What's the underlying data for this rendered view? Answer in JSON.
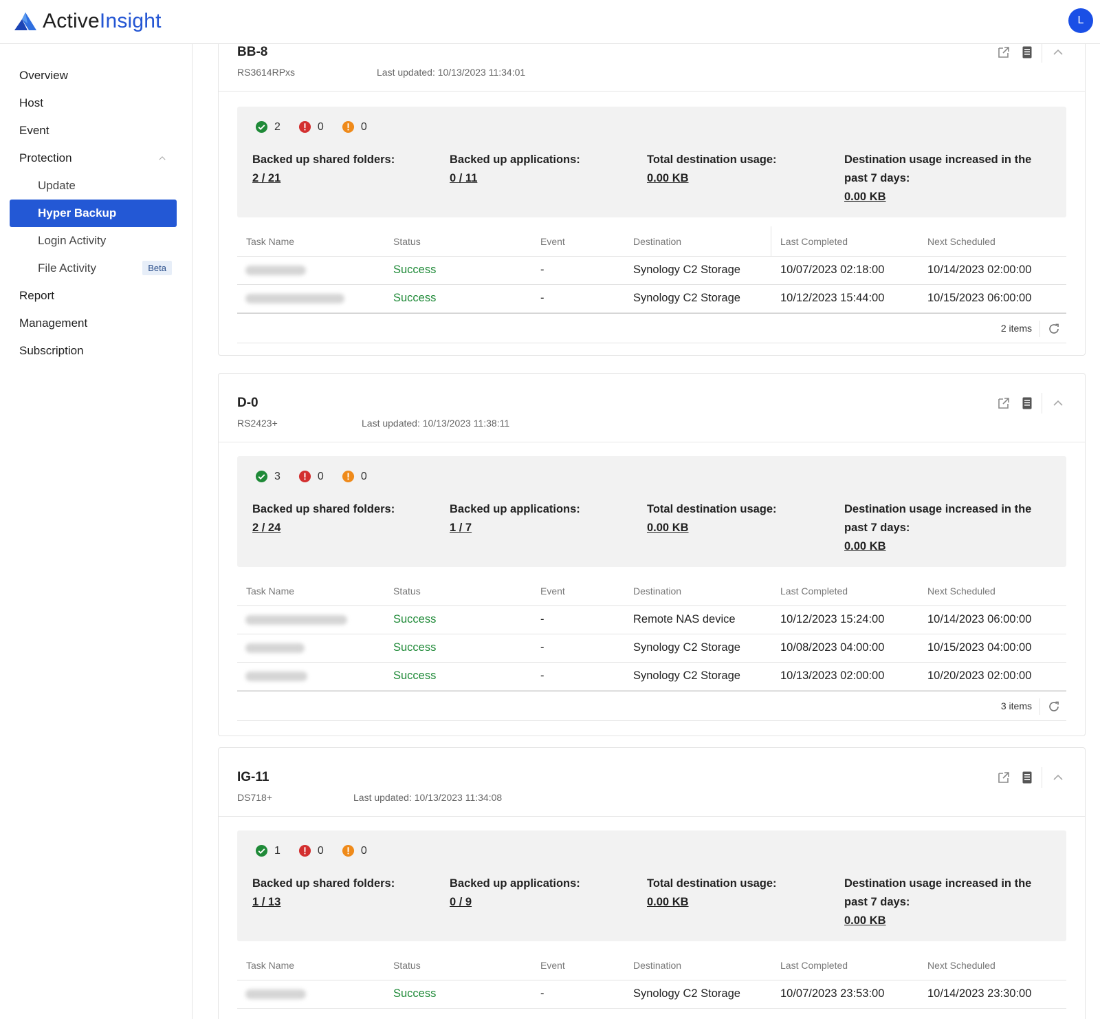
{
  "app": {
    "logo_text_a": "Active",
    "logo_text_b": "Insight",
    "user_initial": "L"
  },
  "sidebar": {
    "items": [
      {
        "label": "Overview"
      },
      {
        "label": "Host"
      },
      {
        "label": "Event"
      },
      {
        "label": "Protection"
      },
      {
        "label": "Update"
      },
      {
        "label": "Hyper Backup"
      },
      {
        "label": "Login Activity"
      },
      {
        "label": "File Activity",
        "badge": "Beta"
      },
      {
        "label": "Report"
      },
      {
        "label": "Management"
      },
      {
        "label": "Subscription"
      }
    ]
  },
  "labels": {
    "shared_folders": "Backed up shared folders:",
    "applications": "Backed up applications:",
    "total_usage": "Total destination usage:",
    "usage_increase": "Destination usage increased in the past 7 days:",
    "col_task": "Task Name",
    "col_status": "Status",
    "col_event": "Event",
    "col_destination": "Destination",
    "col_last": "Last Completed",
    "col_next": "Next Scheduled"
  },
  "colors": {
    "accent": "#2358d5",
    "success": "#1f8a38",
    "error": "#d32f2f",
    "warning": "#ef8a1a"
  },
  "hosts": [
    {
      "name": "BB-8",
      "model": "RS3614RPxs",
      "updated": "Last updated: 10/13/2023 11:34:01",
      "counts": {
        "success": "2",
        "error": "0",
        "warning": "0"
      },
      "shared_folders": "2 / 21",
      "applications": "0 / 11",
      "total_usage": "0.00 KB",
      "usage_increase": "0.00 KB",
      "rows": [
        {
          "status": "Success",
          "event": "-",
          "destination": "Synology C2 Storage",
          "last": "10/07/2023 02:18:00",
          "next": "10/14/2023 02:00:00"
        },
        {
          "status": "Success",
          "event": "-",
          "destination": "Synology C2 Storage",
          "last": "10/12/2023 15:44:00",
          "next": "10/15/2023 06:00:00"
        }
      ],
      "items": "2 items"
    },
    {
      "name": "D-0",
      "model": "RS2423+",
      "updated": "Last updated: 10/13/2023 11:38:11",
      "counts": {
        "success": "3",
        "error": "0",
        "warning": "0"
      },
      "shared_folders": "2 / 24",
      "applications": "1 / 7",
      "total_usage": "0.00 KB",
      "usage_increase": "0.00 KB",
      "rows": [
        {
          "status": "Success",
          "event": "-",
          "destination": "Remote NAS device",
          "last": "10/12/2023 15:24:00",
          "next": "10/14/2023 06:00:00"
        },
        {
          "status": "Success",
          "event": "-",
          "destination": "Synology C2 Storage",
          "last": "10/08/2023 04:00:00",
          "next": "10/15/2023 04:00:00"
        },
        {
          "status": "Success",
          "event": "-",
          "destination": "Synology C2 Storage",
          "last": "10/13/2023 02:00:00",
          "next": "10/20/2023 02:00:00"
        }
      ],
      "items": "3 items"
    },
    {
      "name": "IG-11",
      "model": "DS718+",
      "updated": "Last updated: 10/13/2023 11:34:08",
      "counts": {
        "success": "1",
        "error": "0",
        "warning": "0"
      },
      "shared_folders": "1 / 13",
      "applications": "0 / 9",
      "total_usage": "0.00 KB",
      "usage_increase": "0.00 KB",
      "rows": [
        {
          "status": "Success",
          "event": "-",
          "destination": "Synology C2 Storage",
          "last": "10/07/2023 23:53:00",
          "next": "10/14/2023 23:30:00"
        }
      ]
    }
  ]
}
